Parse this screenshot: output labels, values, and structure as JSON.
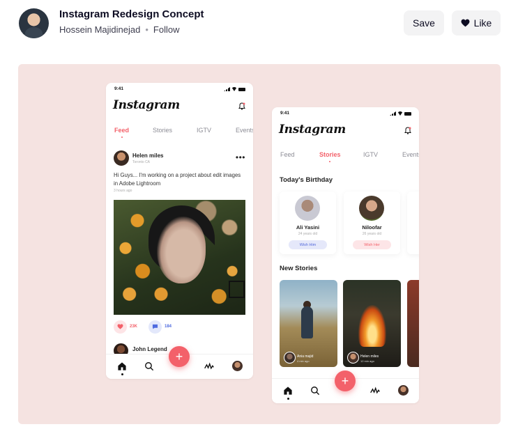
{
  "shot": {
    "title": "Instagram Redesign Concept",
    "author": "Hossein Majidinejad",
    "separator": "•",
    "follow_label": "Follow",
    "save_label": "Save",
    "like_label": "Like"
  },
  "colors": {
    "accent": "#f3616a",
    "canvas_bg": "#f5e3e1",
    "comment_blue": "#4f6bdf"
  },
  "phone1": {
    "time": "9:41",
    "logo": "Instagram",
    "tabs": [
      "Feed",
      "Stories",
      "IGTV",
      "Events"
    ],
    "active_tab": "Feed",
    "post": {
      "user": "Helen miles",
      "location": "Toronto CA",
      "caption": "Hi Guys... I'm working on a project about edit images in Adobe Lightroom",
      "time": "3 hours ago",
      "likes": "23K",
      "comments": "184"
    },
    "next_post_user": "John Legend",
    "nav_icons": [
      "home-icon",
      "search-icon",
      "add-icon",
      "activity-icon",
      "profile-icon"
    ],
    "fab": "+"
  },
  "phone2": {
    "time": "9:41",
    "logo": "Instagram",
    "tabs": [
      "Feed",
      "Stories",
      "IGTV",
      "Events"
    ],
    "active_tab": "Stories",
    "birthday_title": "Today's Birthday",
    "birthdays": [
      {
        "name": "Ali Yasini",
        "age": "24 years old",
        "action": "Wish Him"
      },
      {
        "name": "Niloofar",
        "age": "26 years old",
        "action": "Wish Her"
      }
    ],
    "stories_title": "New Stories",
    "stories": [
      {
        "user": "Ania majid",
        "time": "4 min ago"
      },
      {
        "user": "Helen miles",
        "time": "12 min ago"
      }
    ],
    "fab": "+"
  }
}
